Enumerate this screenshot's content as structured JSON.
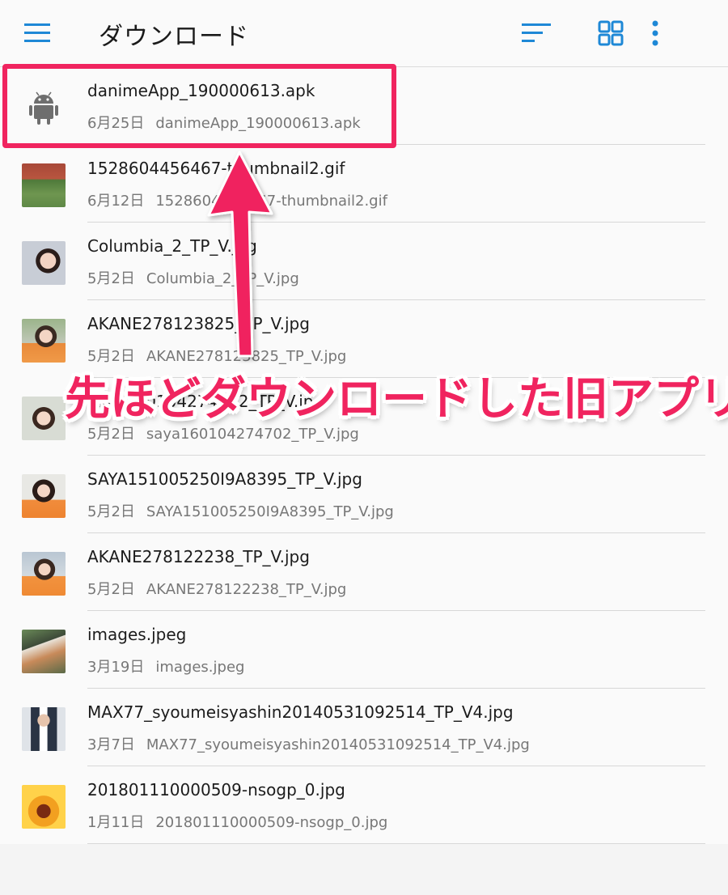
{
  "toolbar": {
    "title": "ダウンロード",
    "menu_icon": "hamburger-menu-icon",
    "sort_icon": "sort-icon",
    "grid_icon": "grid-view-icon",
    "more_icon": "more-vert-icon",
    "icon_color": "#1e88d6"
  },
  "files": [
    {
      "name": "danimeApp_190000613.apk",
      "date": "6月25日",
      "path": "danimeApp_190000613.apk",
      "thumb": "android-icon"
    },
    {
      "name": "1528604456467-thumbnail2.gif",
      "date": "6月12日",
      "path": "1528604456467-thumbnail2.gif",
      "thumb": "image-thumbnail"
    },
    {
      "name": "Columbia_2_TP_V.jpg",
      "date": "5月2日",
      "path": "Columbia_2_TP_V.jpg",
      "thumb": "image-thumbnail"
    },
    {
      "name": "AKANE278123825_TP_V.jpg",
      "date": "5月2日",
      "path": "AKANE278123825_TP_V.jpg",
      "thumb": "image-thumbnail"
    },
    {
      "name": "saya160104274702_TP_V.jpg",
      "date": "5月2日",
      "path": "saya160104274702_TP_V.jpg",
      "thumb": "image-thumbnail"
    },
    {
      "name": "SAYA151005250I9A8395_TP_V.jpg",
      "date": "5月2日",
      "path": "SAYA151005250I9A8395_TP_V.jpg",
      "thumb": "image-thumbnail"
    },
    {
      "name": "AKANE278122238_TP_V.jpg",
      "date": "5月2日",
      "path": "AKANE278122238_TP_V.jpg",
      "thumb": "image-thumbnail"
    },
    {
      "name": "images.jpeg",
      "date": "3月19日",
      "path": "images.jpeg",
      "thumb": "image-thumbnail"
    },
    {
      "name": "MAX77_syoumeisyashin20140531092514_TP_V4.jpg",
      "date": "3月7日",
      "path": "MAX77_syoumeisyashin20140531092514_TP_V4.jpg",
      "thumb": "image-thumbnail"
    },
    {
      "name": "201801110000509-nsogp_0.jpg",
      "date": "1月11日",
      "path": "201801110000509-nsogp_0.jpg",
      "thumb": "image-thumbnail"
    }
  ],
  "annotation": {
    "text": "先ほどダウンロードした旧アプリ",
    "color": "#f0245f"
  }
}
